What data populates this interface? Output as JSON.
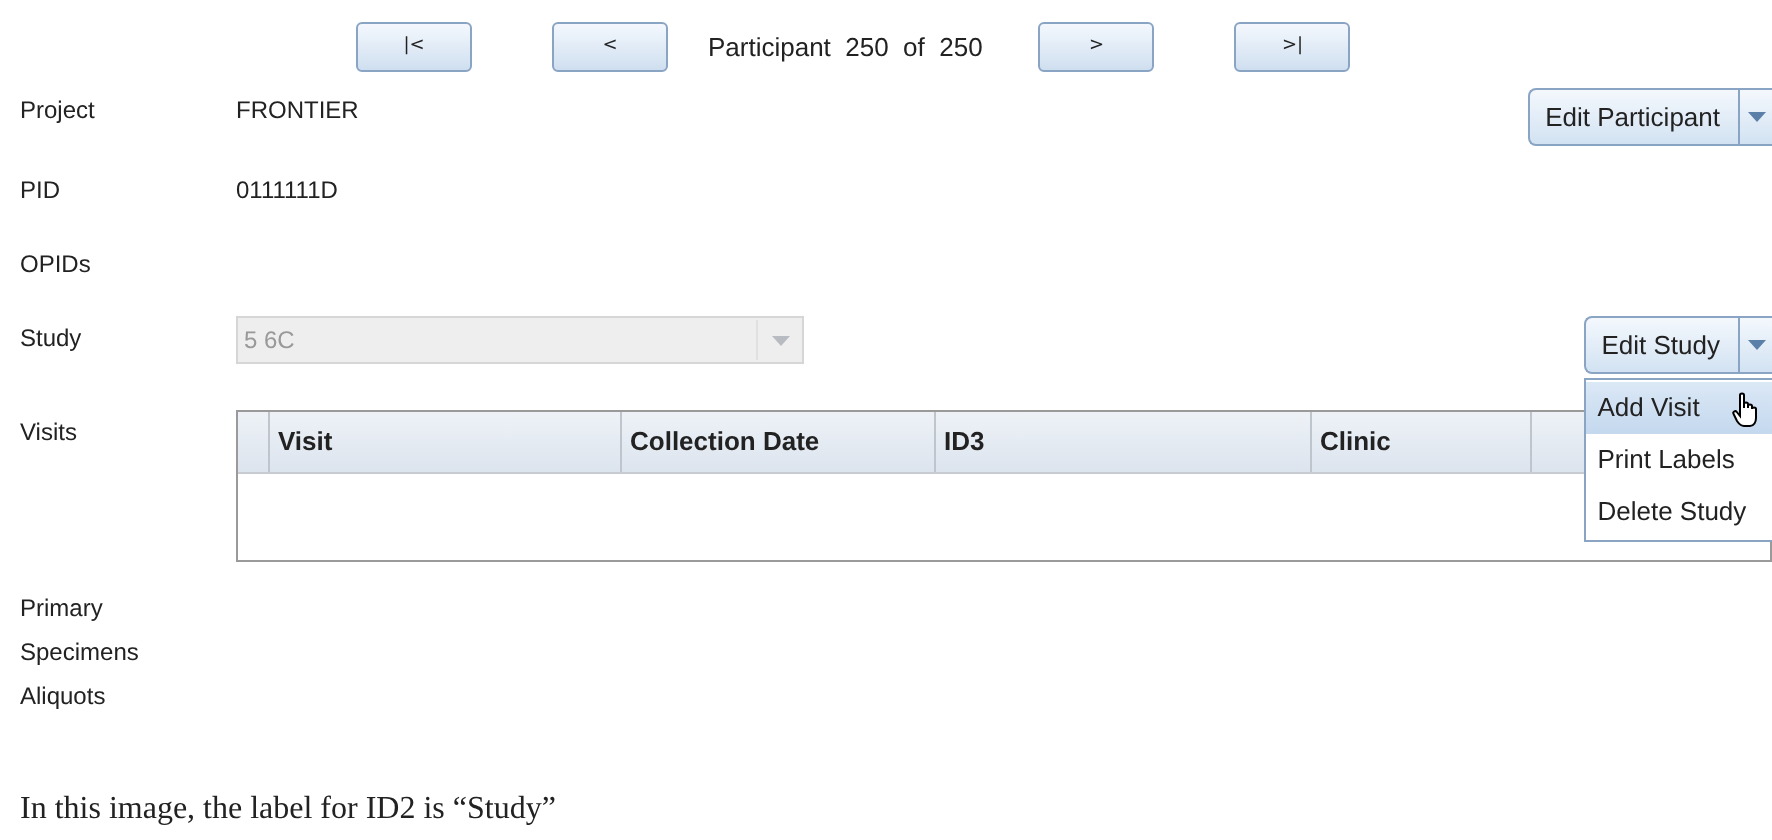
{
  "navigation": {
    "buttons": [
      {
        "kind": "first",
        "label": "|<"
      },
      {
        "kind": "prev",
        "label": "<"
      },
      {
        "kind": "next",
        "label": ">"
      },
      {
        "kind": "last",
        "label": ">|"
      }
    ],
    "participant_label": "Participant",
    "current": "250",
    "of_label": "of",
    "total": "250"
  },
  "fields": [
    {
      "kind": "text",
      "label": "Project",
      "value": "FRONTIER",
      "action": "Edit Participant"
    },
    {
      "kind": "text",
      "label": "PID",
      "value": "0111111D"
    },
    {
      "kind": "text",
      "label": "OPIDs"
    },
    {
      "kind": "combo",
      "label": "Study",
      "value": "5 6C",
      "disabled": true,
      "action": "Edit Study"
    },
    {
      "kind": "table",
      "label": "Visits",
      "columns": [
        "Visit",
        "Collection Date",
        "ID3",
        "Clinic"
      ]
    },
    {
      "kind": "text",
      "label": "Primary\nSpecimens"
    },
    {
      "kind": "text",
      "label": "Aliquots"
    }
  ],
  "menu": [
    {
      "label": "Add Visit",
      "selected": true
    },
    {
      "label": "Print Labels",
      "selected": false
    },
    {
      "label": "Delete Study",
      "selected": false
    }
  ],
  "caption": "In this image, the label for ID2 is “Study”"
}
